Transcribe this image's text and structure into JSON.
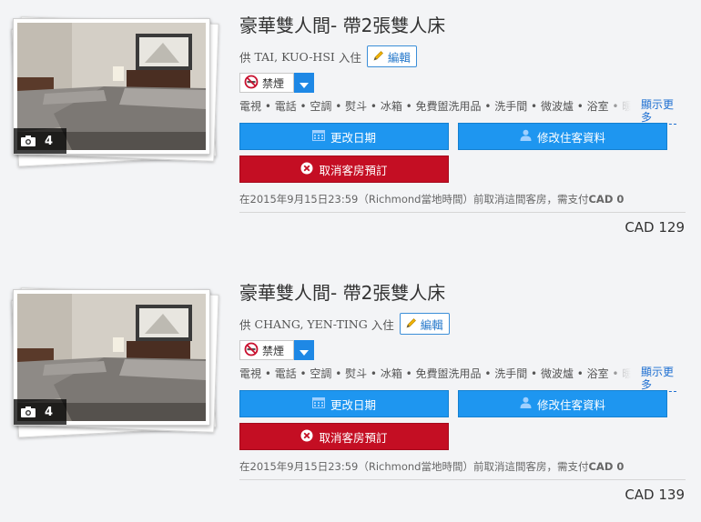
{
  "rooms": [
    {
      "photo_count": "4",
      "title": "豪華雙人間- 帶2張雙人床",
      "guest_prefix": "供",
      "guest_name": "TAI, KUO-HSI",
      "guest_suffix": "入住",
      "edit_label": "編輯",
      "smoking_label": "禁煙",
      "amenities": "電視 • 電話 • 空調 • 熨斗 • 冰箱 • 免費盥洗用品 • 洗手間 • 微波爐 • 浴室 • 暖氣 • 有",
      "show_more_label": "顯示更多",
      "change_date_label": "更改日期",
      "modify_guest_label": "修改住客資料",
      "cancel_label": "取消客房預訂",
      "policy_prefix": "在2015年9月15日23:59（Richmond當地時間）前取消這間客房，需支付",
      "policy_amount": "CAD 0",
      "price": "CAD 129"
    },
    {
      "photo_count": "4",
      "title": "豪華雙人間- 帶2張雙人床",
      "guest_prefix": "供",
      "guest_name": "CHANG, YEN-TING",
      "guest_suffix": "入住",
      "edit_label": "編輯",
      "smoking_label": "禁煙",
      "amenities": "電視 • 電話 • 空調 • 熨斗 • 冰箱 • 免費盥洗用品 • 洗手間 • 微波爐 • 浴室 • 暖氣 • 有",
      "show_more_label": "顯示更多",
      "change_date_label": "更改日期",
      "modify_guest_label": "修改住客資料",
      "cancel_label": "取消客房預訂",
      "policy_prefix": "在2015年9月15日23:59（Richmond當地時間）前取消這間客房，需支付",
      "policy_amount": "CAD 0",
      "price": "CAD 139"
    }
  ],
  "icons": {
    "camera": "camera-icon",
    "pencil": "pencil-icon",
    "no_smoking": "no-smoking-icon",
    "dropdown": "chevron-down-icon",
    "calendar": "calendar-icon",
    "user": "user-icon",
    "cancel": "cancel-circle-icon"
  },
  "colors": {
    "primary_button": "#1e96f0",
    "cancel_button": "#c40e23",
    "link": "#1e6fd1",
    "dropdown": "#1e88e5"
  }
}
